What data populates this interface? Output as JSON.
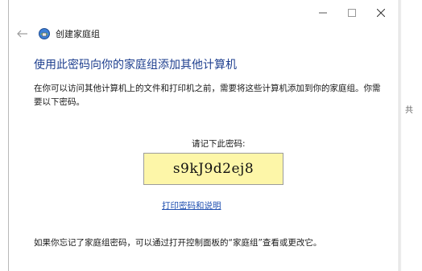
{
  "window": {
    "title": "创建家庭组",
    "minimize_glyph": "—",
    "maximize_glyph": "☐",
    "close_glyph": "✕"
  },
  "nav": {
    "back_glyph": "←"
  },
  "content": {
    "heading": "使用此密码向你的家庭组添加其他计算机",
    "description": "在你可以访问其他计算机上的文件和打印机之前，需要将这些计算机添加到你的家庭组。你需要以下密码。",
    "password_label": "请记下此密码:",
    "password": "s9kJ9d2ej8",
    "print_link": "打印密码和说明",
    "footer": "如果你忘记了家庭组密码，可以通过打开控制面板的“家庭组”查看或更改它。"
  },
  "background": {
    "glyph": "共"
  },
  "colors": {
    "heading": "#1e3f8f",
    "link": "#1f4fb0",
    "password_bg": "#fdf6a8"
  }
}
